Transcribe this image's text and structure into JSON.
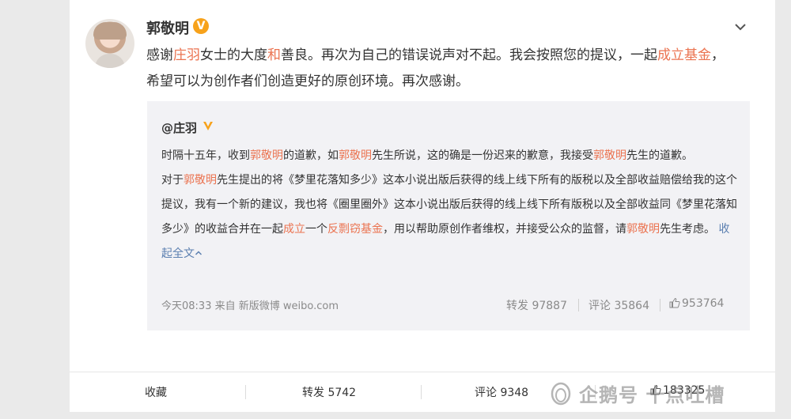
{
  "post": {
    "author": "郭敬明",
    "verified_mark": "V",
    "text_parts": [
      {
        "t": "感谢",
        "hl": false
      },
      {
        "t": "庄羽",
        "hl": true
      },
      {
        "t": "女士的大度",
        "hl": false
      },
      {
        "t": "和",
        "hl": true
      },
      {
        "t": "善良。再次为自己的错误说声对不起。我会按照您的提议，一起",
        "hl": false
      },
      {
        "t": "成立基金",
        "hl": true
      },
      {
        "t": "，希望可以为创作者们创造更好的原创环境。再次感谢。",
        "hl": false
      }
    ]
  },
  "quoted": {
    "author": "@庄羽",
    "paragraphs": [
      [
        {
          "t": "时隔十五年，收到",
          "hl": false
        },
        {
          "t": "郭敬明",
          "hl": true
        },
        {
          "t": "的道歉，如",
          "hl": false
        },
        {
          "t": "郭敬明",
          "hl": true
        },
        {
          "t": "先生所说，这的确是一份迟来的歉意，我接受",
          "hl": false
        },
        {
          "t": "郭敬明",
          "hl": true
        },
        {
          "t": "先生的道歉。",
          "hl": false
        }
      ],
      [
        {
          "t": "对于",
          "hl": false
        },
        {
          "t": "郭敬明",
          "hl": true
        },
        {
          "t": "先生提出的将《梦里花落知多少》这本小说出版后获得的线上线下所有的版税以及全部收益赔偿给我的这个提议，我有一个新的建议，我也将《圈里圈外》这本小说出版后获得的线上线下所有版税以及全部收益同《梦里花落知多少》的收益合并在一起",
          "hl": false
        },
        {
          "t": "成立",
          "hl": true
        },
        {
          "t": "一个",
          "hl": false
        },
        {
          "t": "反剽窃基金",
          "hl": true
        },
        {
          "t": "，用以帮助原创作者维权，并接受公众的监督，请",
          "hl": false
        },
        {
          "t": "郭敬明",
          "hl": true
        },
        {
          "t": "先生考虑。",
          "hl": false
        }
      ]
    ],
    "collapse_link": "收起全文",
    "meta": "今天08:33 来自 新版微博 weibo.com",
    "repost": "转发 97887",
    "comment": "评论 35864",
    "like": "953764"
  },
  "bottom_bar": {
    "favorite": "收藏",
    "repost": "转发 5742",
    "comment": "评论 9348",
    "like": "183325"
  },
  "watermark": "企鹅号 十点吐槽",
  "colors": {
    "highlight": "#eb7350",
    "link": "#5b7fb0",
    "verified": "#f7a21b"
  },
  "icons": [
    "chevron-down-icon",
    "verified-icon",
    "thumbs-up-icon",
    "chevron-up-icon"
  ]
}
